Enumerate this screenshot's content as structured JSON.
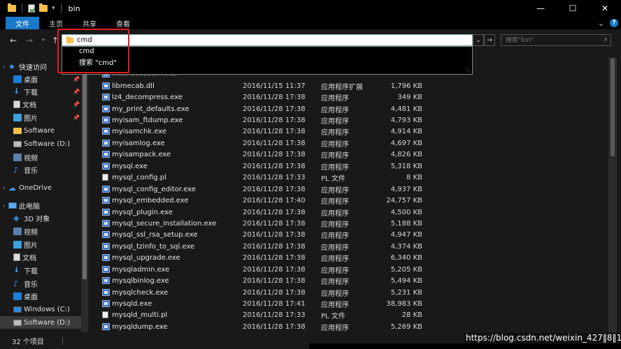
{
  "window": {
    "title": "bin"
  },
  "window_controls": {
    "minimize": "—",
    "maximize": "☐",
    "close": "✕"
  },
  "quick_access_toolbar": {
    "dropdown_glyph": "▾"
  },
  "ribbon": {
    "tabs": [
      "文件",
      "主页",
      "共享",
      "查看"
    ],
    "expand_glyph": "⌄",
    "help_glyph": "?"
  },
  "address_bar": {
    "value": "cmd",
    "dropdown_glyph": "⌄",
    "go_glyph": "→"
  },
  "search": {
    "placeholder": "搜索\"bin\"",
    "icon_glyph": "⌕"
  },
  "autocomplete": {
    "items": [
      "cmd",
      "搜索 \"cmd\""
    ],
    "grip_glyph": "⋱"
  },
  "nav_buttons": {
    "back": "←",
    "forward": "→",
    "recent": "⌄",
    "up": "↑"
  },
  "nav_pane": {
    "pin_glyph": "📌",
    "expand_glyph": "›",
    "items": [
      {
        "label": "快速访问",
        "icon": "star-icon"
      },
      {
        "label": "桌面",
        "icon": "desktop-icon"
      },
      {
        "label": "下载",
        "icon": "download-icon"
      },
      {
        "label": "文档",
        "icon": "documents-icon"
      },
      {
        "label": "图片",
        "icon": "pictures-icon"
      },
      {
        "label": "Software",
        "icon": "folder-icon"
      },
      {
        "label": "Software (D:)",
        "icon": "drive-icon"
      },
      {
        "label": "视频",
        "icon": "videos-icon"
      },
      {
        "label": "音乐",
        "icon": "music-icon"
      },
      {
        "label": "OneDrive",
        "icon": "cloud-icon"
      },
      {
        "label": "此电脑",
        "icon": "computer-icon"
      },
      {
        "label": "3D 对象",
        "icon": "cube-icon"
      },
      {
        "label": "视频",
        "icon": "videos-icon"
      },
      {
        "label": "图片",
        "icon": "pictures-icon"
      },
      {
        "label": "文档",
        "icon": "documents-icon"
      },
      {
        "label": "下载",
        "icon": "download-icon"
      },
      {
        "label": "音乐",
        "icon": "music-icon"
      },
      {
        "label": "桌面",
        "icon": "desktop-icon"
      },
      {
        "label": "Windows (C:)",
        "icon": "windows-drive-icon"
      },
      {
        "label": "Software (D:)",
        "icon": "drive-icon"
      }
    ]
  },
  "files": {
    "partial_row": "mecheckksum.exe",
    "rows": [
      {
        "name": "libmecab.dll",
        "date": "2016/11/15 11:37",
        "type": "应用程序扩展",
        "size": "1,796 KB",
        "icon": "dll-icon"
      },
      {
        "name": "lz4_decompress.exe",
        "date": "2016/11/28 17:38",
        "type": "应用程序",
        "size": "349 KB",
        "icon": "exe-icon"
      },
      {
        "name": "my_print_defaults.exe",
        "date": "2016/11/28 17:38",
        "type": "应用程序",
        "size": "4,481 KB",
        "icon": "exe-icon"
      },
      {
        "name": "myisam_ftdump.exe",
        "date": "2016/11/28 17:38",
        "type": "应用程序",
        "size": "4,793 KB",
        "icon": "exe-icon"
      },
      {
        "name": "myisamchk.exe",
        "date": "2016/11/28 17:38",
        "type": "应用程序",
        "size": "4,914 KB",
        "icon": "exe-icon"
      },
      {
        "name": "myisamlog.exe",
        "date": "2016/11/28 17:38",
        "type": "应用程序",
        "size": "4,697 KB",
        "icon": "exe-icon"
      },
      {
        "name": "myisampack.exe",
        "date": "2016/11/28 17:38",
        "type": "应用程序",
        "size": "4,826 KB",
        "icon": "exe-icon"
      },
      {
        "name": "mysql.exe",
        "date": "2016/11/28 17:38",
        "type": "应用程序",
        "size": "5,318 KB",
        "icon": "exe-icon"
      },
      {
        "name": "mysql_config.pl",
        "date": "2016/11/28 17:33",
        "type": "PL 文件",
        "size": "8 KB",
        "icon": "pl-file-icon"
      },
      {
        "name": "mysql_config_editor.exe",
        "date": "2016/11/28 17:38",
        "type": "应用程序",
        "size": "4,937 KB",
        "icon": "exe-icon"
      },
      {
        "name": "mysql_embedded.exe",
        "date": "2016/11/28 17:40",
        "type": "应用程序",
        "size": "24,757 KB",
        "icon": "exe-icon"
      },
      {
        "name": "mysql_plugin.exe",
        "date": "2016/11/28 17:38",
        "type": "应用程序",
        "size": "4,500 KB",
        "icon": "exe-icon"
      },
      {
        "name": "mysql_secure_installation.exe",
        "date": "2016/11/28 17:38",
        "type": "应用程序",
        "size": "5,188 KB",
        "icon": "exe-icon"
      },
      {
        "name": "mysql_ssl_rsa_setup.exe",
        "date": "2016/11/28 17:38",
        "type": "应用程序",
        "size": "4,947 KB",
        "icon": "exe-icon"
      },
      {
        "name": "mysql_tzinfo_to_sql.exe",
        "date": "2016/11/28 17:38",
        "type": "应用程序",
        "size": "4,374 KB",
        "icon": "exe-icon"
      },
      {
        "name": "mysql_upgrade.exe",
        "date": "2016/11/28 17:38",
        "type": "应用程序",
        "size": "6,340 KB",
        "icon": "exe-icon"
      },
      {
        "name": "mysqladmin.exe",
        "date": "2016/11/28 17:38",
        "type": "应用程序",
        "size": "5,205 KB",
        "icon": "exe-icon"
      },
      {
        "name": "mysqlbinlog.exe",
        "date": "2016/11/28 17:38",
        "type": "应用程序",
        "size": "5,494 KB",
        "icon": "exe-icon"
      },
      {
        "name": "mysqlcheck.exe",
        "date": "2016/11/28 17:38",
        "type": "应用程序",
        "size": "5,231 KB",
        "icon": "exe-icon"
      },
      {
        "name": "mysqld.exe",
        "date": "2016/11/28 17:41",
        "type": "应用程序",
        "size": "38,983 KB",
        "icon": "exe-icon"
      },
      {
        "name": "mysqld_multi.pl",
        "date": "2016/11/28 17:33",
        "type": "PL 文件",
        "size": "28 KB",
        "icon": "pl-file-icon"
      },
      {
        "name": "mysqldump.exe",
        "date": "2016/11/28 17:38",
        "type": "应用程序",
        "size": "5,269 KB",
        "icon": "exe-icon"
      }
    ]
  },
  "status_bar": {
    "count": "32 个项目"
  },
  "watermark": "https://blog.csdn.net/weixin_427‖8‖1",
  "colors": {
    "accent": "#1979ca",
    "highlight_box": "#e21d1d",
    "background": "#191919"
  }
}
